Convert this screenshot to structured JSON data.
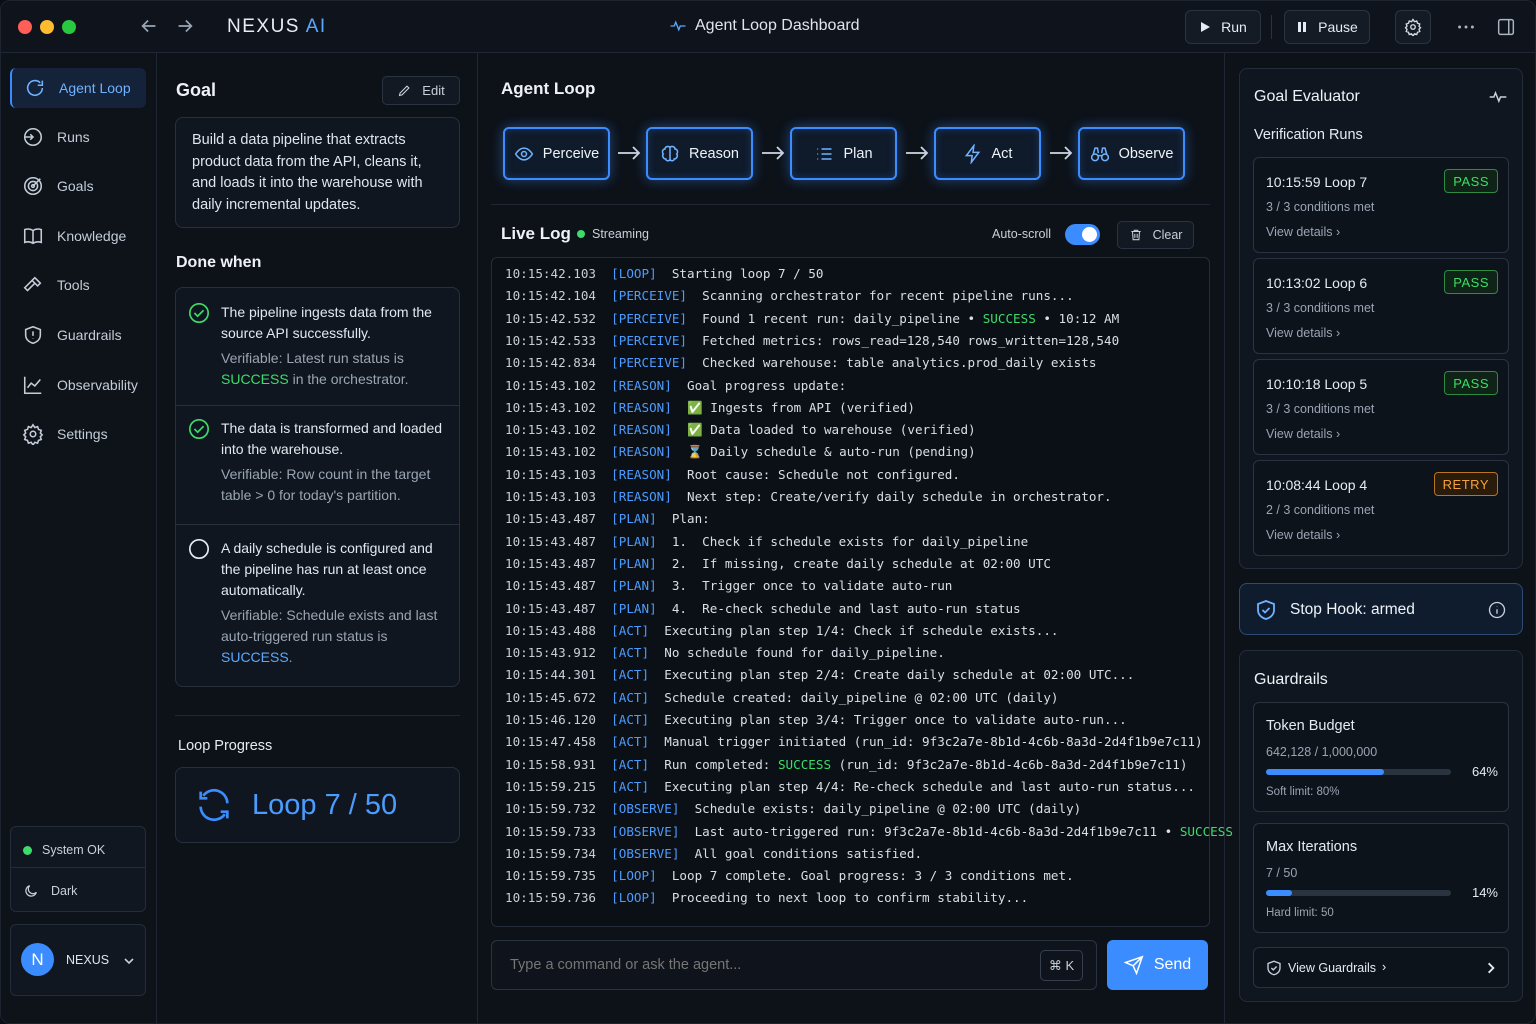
{
  "app": {
    "brand_main": "NEXUS",
    "brand_accent": "AI",
    "window_title": "Agent Loop Dashboard",
    "run_label": "Run",
    "pause_label": "Pause"
  },
  "nav": {
    "items": [
      {
        "label": "Agent Loop",
        "icon": "loop-icon",
        "active": true
      },
      {
        "label": "Runs",
        "icon": "runs-icon"
      },
      {
        "label": "Goals",
        "icon": "target-icon"
      },
      {
        "label": "Knowledge",
        "icon": "book-icon"
      },
      {
        "label": "Tools",
        "icon": "hammer-icon"
      },
      {
        "label": "Guardrails",
        "icon": "shield-icon"
      },
      {
        "label": "Observability",
        "icon": "chart-icon"
      },
      {
        "label": "Settings",
        "icon": "gear-icon"
      }
    ],
    "system_status": "System OK",
    "theme": "Dark",
    "user_initial": "N",
    "user_name": "NEXUS"
  },
  "goal": {
    "title": "Goal",
    "edit_label": "Edit",
    "text": "Build a data pipeline that extracts product data from the API, cleans it, and loads it into the warehouse with daily incremental updates.",
    "done_when_title": "Done when",
    "criteria": [
      {
        "text": "The pipeline ingests data from the source API successfully.",
        "verifiable_prefix": "Verifiable: Latest run status is ",
        "verifiable_value": "SUCCESS",
        "verifiable_suffix": " in the orchestrator.",
        "done": true
      },
      {
        "text": "The data is transformed and loaded into the warehouse.",
        "verifiable": "Verifiable: Row count in the target table > 0 for today's partition.",
        "done": true
      },
      {
        "text": "A daily schedule is configured and the pipeline has run at least once automatically.",
        "verifiable_prefix": "Verifiable: Schedule exists and last auto-triggered run status is ",
        "verifiable_value": "SUCCESS.",
        "done": false
      }
    ],
    "loop_progress_title": "Loop Progress",
    "loop_progress_value": "Loop 7 / 50",
    "loop_current": 7,
    "loop_max": 50
  },
  "agent_loop": {
    "title": "Agent Loop",
    "stages": [
      "Perceive",
      "Reason",
      "Plan",
      "Act",
      "Observe"
    ],
    "stage_icons": [
      "eye-icon",
      "brain-icon",
      "list-icon",
      "bolt-icon",
      "binoculars-icon"
    ]
  },
  "live_log": {
    "title": "Live Log",
    "status": "Streaming",
    "autoscroll_label": "Auto-scroll",
    "autoscroll_on": true,
    "clear_label": "Clear",
    "lines": [
      {
        "ts": "10:15:42.103",
        "tag": "[LOOP]",
        "msg": "Starting loop 7 / 50"
      },
      {
        "ts": "10:15:42.104",
        "tag": "[PERCEIVE]",
        "msg": "Scanning orchestrator for recent pipeline runs..."
      },
      {
        "ts": "10:15:42.532",
        "tag": "[PERCEIVE]",
        "msg": "Found 1 recent run: daily_pipeline • ",
        "ok": "SUCCESS",
        "after": " • 10:12 AM"
      },
      {
        "ts": "10:15:42.533",
        "tag": "[PERCEIVE]",
        "msg": "Fetched metrics: rows_read=128,540 rows_written=128,540"
      },
      {
        "ts": "10:15:42.834",
        "tag": "[PERCEIVE]",
        "msg": "Checked warehouse: table analytics.prod_daily exists"
      },
      {
        "ts": "10:15:43.102",
        "tag": "[REASON]",
        "msg": "Goal progress update:"
      },
      {
        "ts": "10:15:43.102",
        "tag": "[REASON]",
        "msg": "✅ Ingests from API (verified)"
      },
      {
        "ts": "10:15:43.102",
        "tag": "[REASON]",
        "msg": "✅ Data loaded to warehouse (verified)"
      },
      {
        "ts": "10:15:43.102",
        "tag": "[REASON]",
        "msg": "⌛ Daily schedule & auto-run (pending)"
      },
      {
        "ts": "10:15:43.103",
        "tag": "[REASON]",
        "msg": "Root cause: Schedule not configured."
      },
      {
        "ts": "10:15:43.103",
        "tag": "[REASON]",
        "msg": "Next step: Create/verify daily schedule in orchestrator."
      },
      {
        "ts": "10:15:43.487",
        "tag": "[PLAN]",
        "msg": "Plan:"
      },
      {
        "ts": "10:15:43.487",
        "tag": "[PLAN]",
        "msg": "1.  Check if schedule exists for daily_pipeline"
      },
      {
        "ts": "10:15:43.487",
        "tag": "[PLAN]",
        "msg": "2.  If missing, create daily schedule at 02:00 UTC"
      },
      {
        "ts": "10:15:43.487",
        "tag": "[PLAN]",
        "msg": "3.  Trigger once to validate auto-run"
      },
      {
        "ts": "10:15:43.487",
        "tag": "[PLAN]",
        "msg": "4.  Re-check schedule and last auto-run status"
      },
      {
        "ts": "10:15:43.488",
        "tag": "[ACT]",
        "msg": "Executing plan step 1/4: Check if schedule exists..."
      },
      {
        "ts": "10:15:43.912",
        "tag": "[ACT]",
        "msg": "No schedule found for daily_pipeline."
      },
      {
        "ts": "10:15:44.301",
        "tag": "[ACT]",
        "msg": "Executing plan step 2/4: Create daily schedule at 02:00 UTC..."
      },
      {
        "ts": "10:15:45.672",
        "tag": "[ACT]",
        "msg": "Schedule created: daily_pipeline @ 02:00 UTC (daily)"
      },
      {
        "ts": "10:15:46.120",
        "tag": "[ACT]",
        "msg": "Executing plan step 3/4: Trigger once to validate auto-run..."
      },
      {
        "ts": "10:15:47.458",
        "tag": "[ACT]",
        "msg": "Manual trigger initiated (run_id: 9f3c2a7e-8b1d-4c6b-8a3d-2d4f1b9e7c11)"
      },
      {
        "ts": "10:15:58.931",
        "tag": "[ACT]",
        "msg": "Run completed: ",
        "ok": "SUCCESS",
        "after": " (run_id: 9f3c2a7e-8b1d-4c6b-8a3d-2d4f1b9e7c11)"
      },
      {
        "ts": "10:15:59.215",
        "tag": "[ACT]",
        "msg": "Executing plan step 4/4: Re-check schedule and last auto-run status..."
      },
      {
        "ts": "10:15:59.732",
        "tag": "[OBSERVE]",
        "msg": "Schedule exists: daily_pipeline @ 02:00 UTC (daily)"
      },
      {
        "ts": "10:15:59.733",
        "tag": "[OBSERVE]",
        "msg": "Last auto-triggered run: 9f3c2a7e-8b1d-4c6b-8a3d-2d4f1b9e7c11 • ",
        "ok": "SUCCESS",
        "after": ""
      },
      {
        "ts": "10:15:59.734",
        "tag": "[OBSERVE]",
        "msg": "All goal conditions satisfied."
      },
      {
        "ts": "10:15:59.735",
        "tag": "[LOOP]",
        "msg": "Loop 7 complete. Goal progress: 3 / 3 conditions met."
      },
      {
        "ts": "10:15:59.736",
        "tag": "[LOOP]",
        "msg": "Proceeding to next loop to confirm stability..."
      }
    ]
  },
  "command": {
    "placeholder": "Type a command or ask the agent...",
    "shortcut": "⌘ K",
    "send_label": "Send"
  },
  "evaluator": {
    "title": "Goal Evaluator",
    "runs_title": "Verification Runs",
    "runs": [
      {
        "time": "10:15:59",
        "loop": "Loop 7",
        "status": "PASS",
        "conditions": "3 / 3 conditions met",
        "details": "View details"
      },
      {
        "time": "10:13:02",
        "loop": "Loop 6",
        "status": "PASS",
        "conditions": "3 / 3 conditions met",
        "details": "View details"
      },
      {
        "time": "10:10:18",
        "loop": "Loop 5",
        "status": "PASS",
        "conditions": "3 / 3 conditions met",
        "details": "View details"
      },
      {
        "time": "10:08:44",
        "loop": "Loop 4",
        "status": "RETRY",
        "conditions": "2 / 3 conditions met",
        "details": "View details"
      }
    ]
  },
  "stop_hook": {
    "label": "Stop Hook: armed"
  },
  "guardrails": {
    "title": "Guardrails",
    "token_budget": {
      "title": "Token Budget",
      "value": "642,128 / 1,000,000",
      "percent_label": "64%",
      "fraction": 0.64,
      "limit": "Soft limit: 80%"
    },
    "max_iterations": {
      "title": "Max Iterations",
      "value": "7 / 50",
      "percent_label": "14%",
      "fraction": 0.14,
      "limit": "Hard limit: 50"
    },
    "view_label": "View Guardrails"
  },
  "colors": {
    "accent": "#3b8cff",
    "success": "#3ddc6a",
    "retry": "#f5a23a"
  }
}
